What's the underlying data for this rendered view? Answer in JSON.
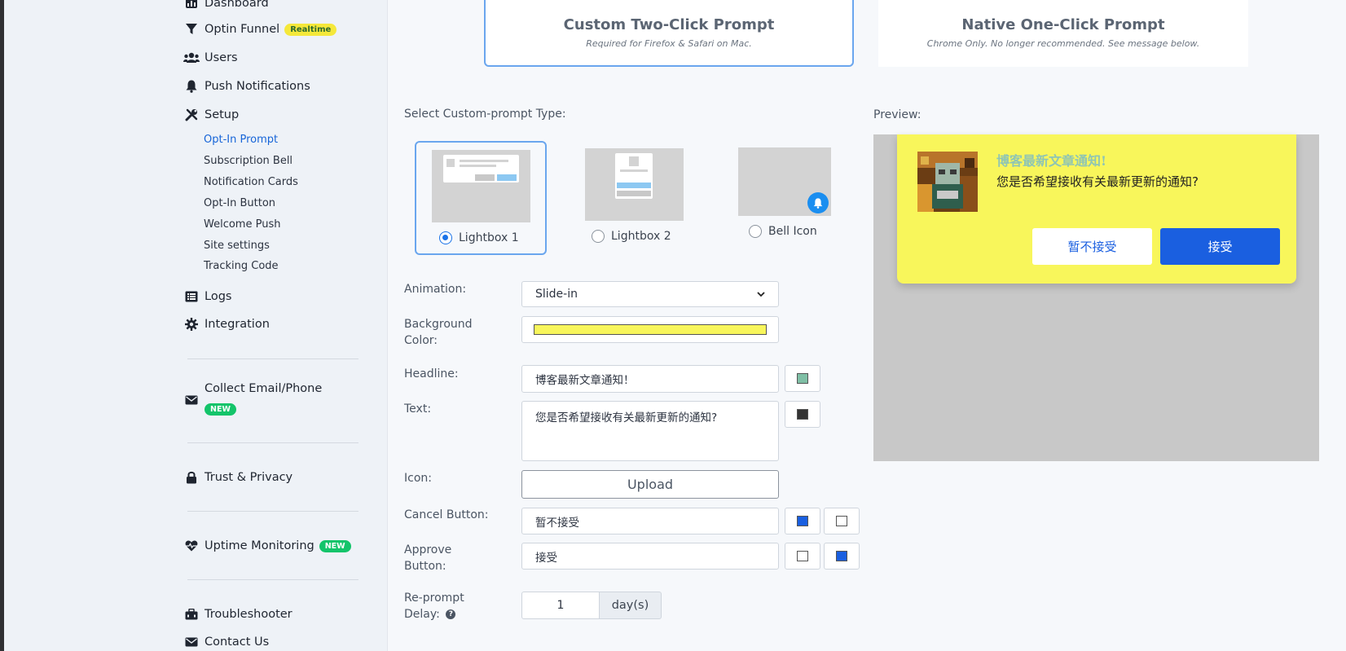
{
  "sidebar": {
    "items": [
      {
        "label": "Dashboard",
        "icon": "dashboard-icon"
      },
      {
        "label": "Optin Funnel",
        "icon": "funnel-icon",
        "badge": "Realtime"
      },
      {
        "label": "Users",
        "icon": "users-icon"
      },
      {
        "label": "Push Notifications",
        "icon": "bell-icon"
      },
      {
        "label": "Setup",
        "icon": "tools-icon"
      }
    ],
    "setup_sub": [
      {
        "label": "Opt-In Prompt",
        "active": true
      },
      {
        "label": "Subscription Bell"
      },
      {
        "label": "Notification Cards"
      },
      {
        "label": "Opt-In Button"
      },
      {
        "label": "Welcome Push"
      },
      {
        "label": "Site settings"
      },
      {
        "label": "Tracking Code"
      }
    ],
    "items2": [
      {
        "label": "Logs",
        "icon": "list-icon"
      },
      {
        "label": "Integration",
        "icon": "gear-icon"
      }
    ],
    "collect": {
      "label": "Collect Email/Phone",
      "badge": "NEW",
      "icon": "envelope-icon"
    },
    "trust": {
      "label": "Trust & Privacy",
      "icon": "lock-icon"
    },
    "uptime": {
      "label": "Uptime Monitoring",
      "badge": "NEW",
      "icon": "heartbeat-icon"
    },
    "troubleshooter": {
      "label": "Troubleshooter",
      "icon": "toolbox-icon"
    },
    "contact": {
      "label": "Contact Us",
      "icon": "envelope-icon"
    }
  },
  "prompt_cards": {
    "custom": {
      "title": "Custom Two-Click Prompt",
      "subtitle": "Required for Firefox & Safari on Mac."
    },
    "native": {
      "title": "Native One-Click Prompt",
      "subtitle": "Chrome Only. No longer recommended. See message below."
    }
  },
  "form": {
    "select_type_label": "Select Custom-prompt Type:",
    "types": [
      {
        "label": "Lightbox 1",
        "selected": true
      },
      {
        "label": "Lightbox 2",
        "selected": false
      },
      {
        "label": "Bell Icon",
        "selected": false
      }
    ],
    "animation": {
      "label": "Animation:",
      "value": "Slide-in"
    },
    "background_color": {
      "label": "Background Color:",
      "value": "#f8f65b"
    },
    "headline": {
      "label": "Headline:",
      "value": "博客最新文章通知！",
      "color": "#7fbfa5"
    },
    "text": {
      "label": "Text:",
      "value": "您是否希望接收有关最新更新的通知?",
      "color": "#333333"
    },
    "icon": {
      "label": "Icon:",
      "upload_label": "Upload"
    },
    "cancel_button": {
      "label": "Cancel Button:",
      "value": "暂不接受",
      "text_color": "#1a5fe0",
      "bg_color": "#ffffff"
    },
    "approve_button": {
      "label": "Approve Button:",
      "value": "接受",
      "text_color": "#ffffff",
      "bg_color": "#1a5fe0"
    },
    "reprompt": {
      "label": "Re-prompt Delay:",
      "value": "1",
      "unit": "day(s)"
    }
  },
  "preview": {
    "label": "Preview:",
    "bg_color": "#f8f65b",
    "headline": "博客最新文章通知!",
    "headline_color": "#8fc5b4",
    "text": "您是否希望接收有关最新更新的通知?",
    "cancel_label": "暂不接受",
    "approve_label": "接受"
  }
}
